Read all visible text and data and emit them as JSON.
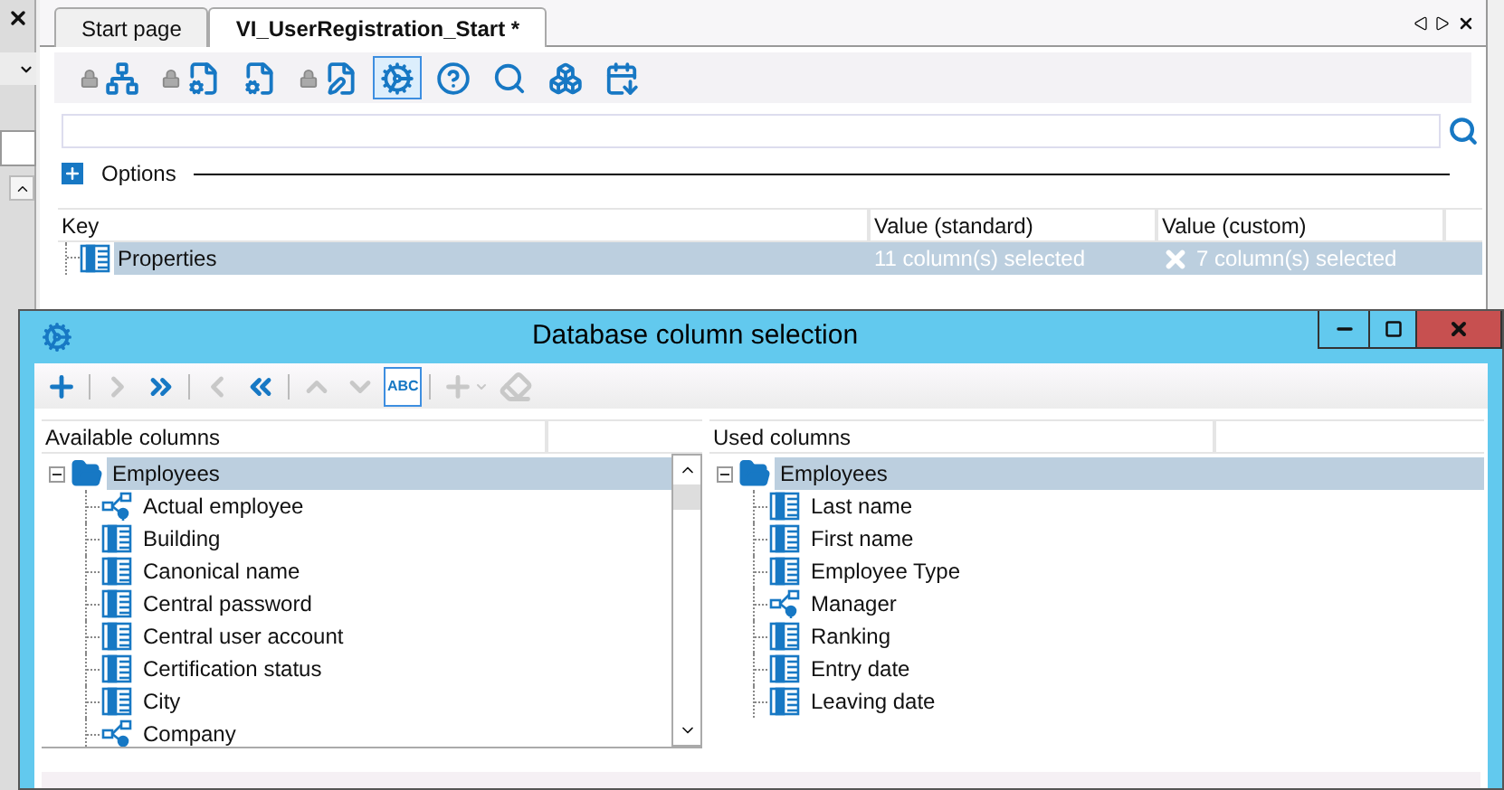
{
  "document_tabs": [
    {
      "label": "Start page",
      "selected": false
    },
    {
      "label": "VI_UserRegistration_Start *",
      "selected": true
    }
  ],
  "toolbar": [
    {
      "locked": true,
      "selected": false
    },
    {
      "locked": true,
      "selected": false
    },
    {
      "locked": false,
      "selected": false
    },
    {
      "locked": true,
      "selected": false
    },
    {
      "locked": false,
      "selected": true
    },
    {
      "locked": false,
      "selected": false
    },
    {
      "locked": false,
      "selected": false
    },
    {
      "locked": false,
      "selected": false
    },
    {
      "locked": false,
      "selected": false
    }
  ],
  "options": {
    "label": "Options",
    "expanded": false
  },
  "table": {
    "columns": [
      "Key",
      "Value (standard)",
      "Value (custom)"
    ],
    "rows": [
      {
        "key": "Properties",
        "standard": "11 column(s) selected",
        "custom": "7 column(s) selected",
        "selected": true
      }
    ]
  },
  "dialog": {
    "title": "Database column selection",
    "toolbar": [
      {
        "kind": "button",
        "disabled": false,
        "selected": false
      },
      {
        "kind": "separator"
      },
      {
        "kind": "button",
        "disabled": true,
        "selected": false
      },
      {
        "kind": "button",
        "disabled": false,
        "selected": false
      },
      {
        "kind": "separator"
      },
      {
        "kind": "button",
        "disabled": true,
        "selected": false
      },
      {
        "kind": "button",
        "disabled": false,
        "selected": false
      },
      {
        "kind": "separator"
      },
      {
        "kind": "button",
        "disabled": true,
        "selected": false
      },
      {
        "kind": "button",
        "disabled": true,
        "selected": false
      },
      {
        "kind": "button",
        "label": "ABC",
        "disabled": false,
        "selected": true
      },
      {
        "kind": "separator"
      },
      {
        "kind": "button",
        "disabled": true,
        "selected": false
      },
      {
        "kind": "button",
        "disabled": true,
        "selected": false
      }
    ],
    "available": {
      "header": "Available columns",
      "root": {
        "label": "Employees",
        "expanded": true,
        "selected": true
      },
      "children": [
        {
          "label": "Actual employee",
          "kind": "relation"
        },
        {
          "label": "Building",
          "kind": "column"
        },
        {
          "label": "Canonical name",
          "kind": "column"
        },
        {
          "label": "Central password",
          "kind": "column"
        },
        {
          "label": "Central user account",
          "kind": "column"
        },
        {
          "label": "Certification status",
          "kind": "column"
        },
        {
          "label": "City",
          "kind": "column"
        },
        {
          "label": "Company",
          "kind": "relation"
        }
      ]
    },
    "used": {
      "header": "Used columns",
      "root": {
        "label": "Employees",
        "expanded": true,
        "selected": true
      },
      "children": [
        {
          "label": "Last name",
          "kind": "column"
        },
        {
          "label": "First name",
          "kind": "column"
        },
        {
          "label": "Employee Type",
          "kind": "column"
        },
        {
          "label": "Manager",
          "kind": "relation"
        },
        {
          "label": "Ranking",
          "kind": "column"
        },
        {
          "label": "Entry date",
          "kind": "column"
        },
        {
          "label": "Leaving date",
          "kind": "column"
        }
      ]
    }
  }
}
